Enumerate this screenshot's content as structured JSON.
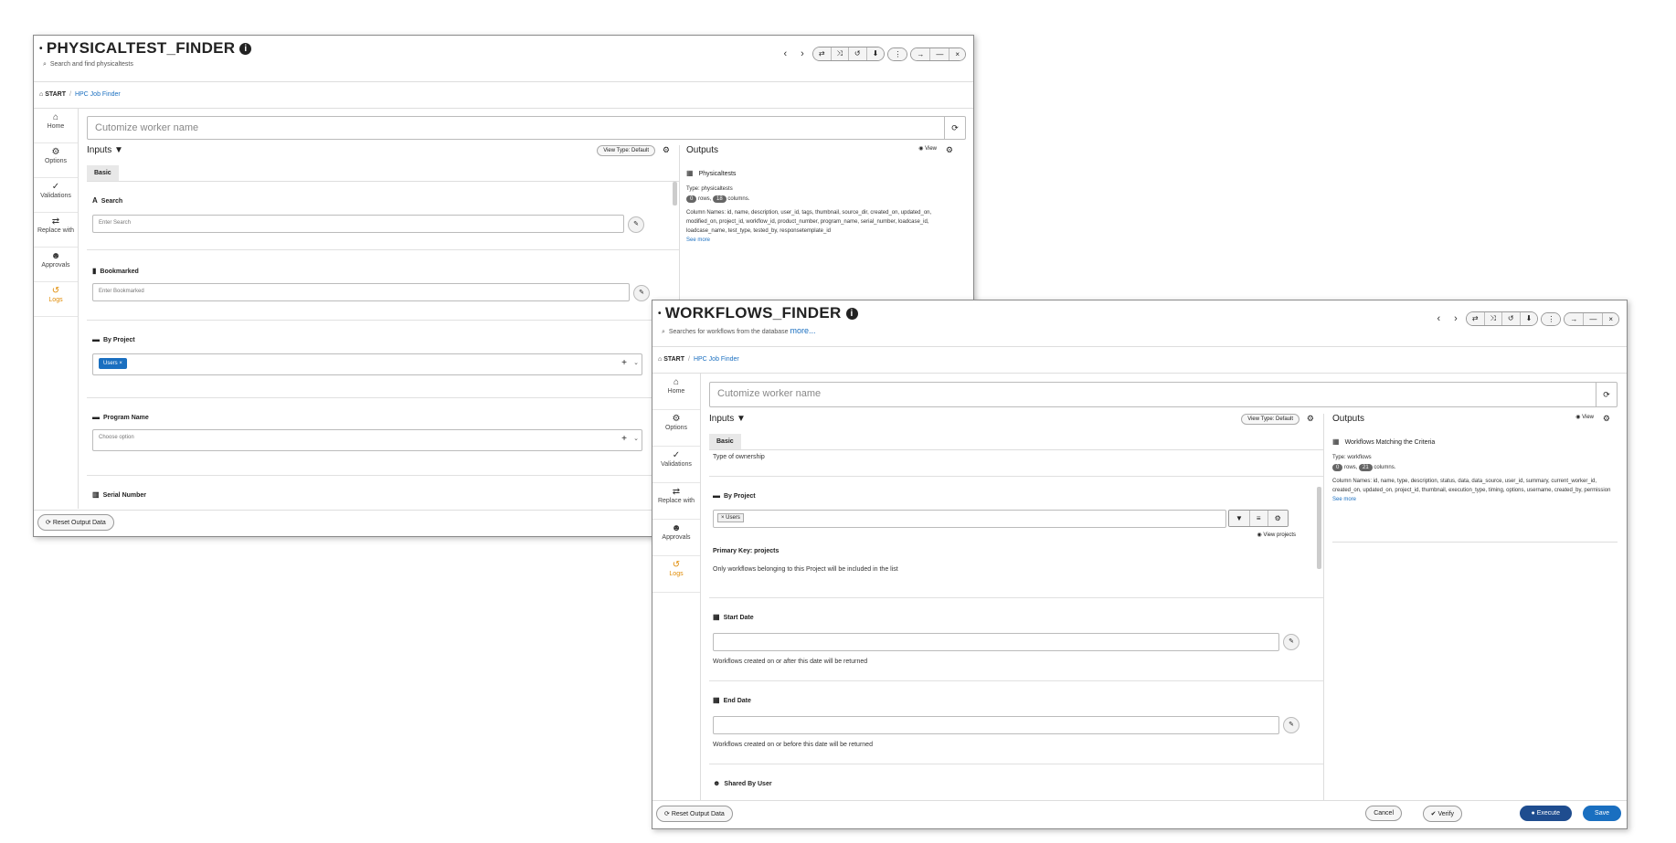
{
  "win1": {
    "title": "PHYSICALTEST_FINDER",
    "subtitle": "Search and find physicaltests",
    "nav": {
      "prev": "‹",
      "next": "›"
    },
    "crumb": {
      "home": "START",
      "link": "HPC Job Finder"
    },
    "worker_placeholder": "Cutomize worker name",
    "inputs_title": "Inputs ▼",
    "view_type": "View Type: Default",
    "tab": "Basic",
    "fields": {
      "search": {
        "label": "Search",
        "placeholder": "Enter Search"
      },
      "bookmarked": {
        "label": "Bookmarked",
        "placeholder": "Enter Bookmarked"
      },
      "by_project": {
        "label": "By Project",
        "chip": "Users ×"
      },
      "program_name": {
        "label": "Program Name",
        "placeholder": "Choose option"
      },
      "serial_number": {
        "label": "Serial Number"
      }
    },
    "outputs": {
      "title": "Outputs",
      "view": "View",
      "name": "Physicaltests",
      "type": "Type: physicaltests",
      "rows": "0",
      "rows_label": "rows,",
      "cols": "18",
      "cols_label": "columns.",
      "column_names": "Column Names: id, name, description, user_id, tags, thumbnail, source_dir, created_on, updated_on, modified_on, project_id, workflow_id, product_number, program_name, serial_number, loadcase_id, loadcase_name, test_type, tested_by, responsetemplate_id",
      "see_more": "See more"
    },
    "reset": "Reset Output Data"
  },
  "win2": {
    "title": "WORKFLOWS_FINDER",
    "subtitle": "Searches for workflows from the database",
    "more": "more...",
    "nav": {
      "prev": "‹",
      "next": "›"
    },
    "crumb": {
      "home": "START",
      "link": "HPC Job Finder"
    },
    "worker_placeholder": "Cutomize worker name",
    "inputs_title": "Inputs ▼",
    "view_type": "View Type: Default",
    "tab": "Basic",
    "type_ownership": "Type of ownership",
    "by_project": {
      "label": "By Project",
      "chip": "× Users",
      "view_projects": "View projects",
      "pk": "Primary Key: projects",
      "help": "Only workflows belonging to this Project will be included in the list"
    },
    "start_date": {
      "label": "Start Date",
      "help": "Workflows created on or after this date will be returned"
    },
    "end_date": {
      "label": "End Date",
      "help": "Workflows created on or before this date will be returned"
    },
    "shared": {
      "label": "Shared By User"
    },
    "outputs": {
      "title": "Outputs",
      "view": "View",
      "name": "Workflows Matching the Criteria",
      "type": "Type: workflows",
      "rows": "0",
      "rows_label": "rows,",
      "cols": "21",
      "cols_label": "columns.",
      "column_names": "Column Names: id, name, type, description, status, data, data_source, user_id, summary, current_worker_id, created_on, updated_on, project_id, thumbnail, execution_type, timing, options, username, created_by, permission",
      "see_more": "See more"
    },
    "buttons": {
      "reset": "Reset Output Data",
      "cancel": "Cancel",
      "verify": "Verify",
      "execute": "Execute",
      "save": "Save"
    }
  },
  "sidebar": [
    {
      "icon": "home-icon",
      "glyph": "⌂",
      "label": "Home"
    },
    {
      "icon": "gear-icon",
      "glyph": "⚙",
      "label": "Options"
    },
    {
      "icon": "check-icon",
      "glyph": "✓",
      "label": "Validations"
    },
    {
      "icon": "swap-icon",
      "glyph": "⇄",
      "label": "Replace with"
    },
    {
      "icon": "user-icon",
      "glyph": "☻",
      "label": "Approvals"
    },
    {
      "icon": "history-icon",
      "glyph": "↺",
      "label": "Logs"
    }
  ],
  "toolbar_glyphs": [
    "⇄",
    "⤨",
    "↺",
    "⬇",
    "⋮",
    "→",
    "—",
    "×"
  ],
  "colors": {
    "accent": "#1a6fc0",
    "execute": "#1f4d8f",
    "logs": "#e08a00"
  }
}
